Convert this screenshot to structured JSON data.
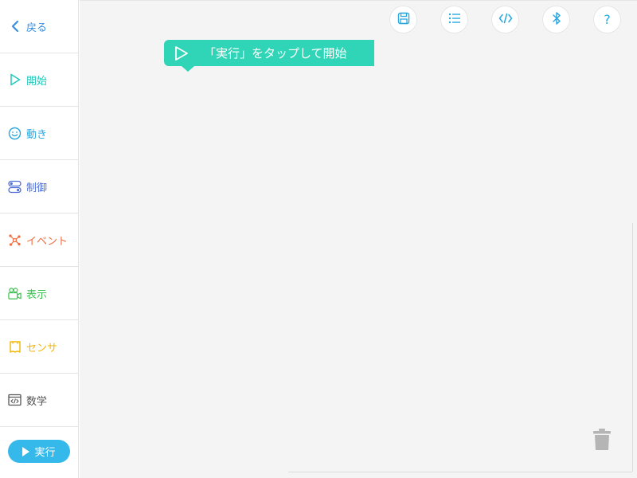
{
  "sidebar": {
    "back": {
      "label": "戻る",
      "icon": "chevron-left-icon",
      "color": "#3a8fe0"
    },
    "items": [
      {
        "label": "開始",
        "icon": "play-outline-icon",
        "color": "#22c7b8"
      },
      {
        "label": "動き",
        "icon": "smiley-icon",
        "color": "#27a6e0"
      },
      {
        "label": "制御",
        "icon": "toggle-control-icon",
        "color": "#4f6fd8"
      },
      {
        "label": "イベント",
        "icon": "network-nodes-icon",
        "color": "#f06b3f"
      },
      {
        "label": "表示",
        "icon": "video-camera-icon",
        "color": "#3ec253"
      },
      {
        "label": "センサ",
        "icon": "sensor-frame-icon",
        "color": "#f2b705"
      },
      {
        "label": "数学",
        "icon": "code-window-icon",
        "color": "#555555"
      }
    ],
    "run_button": {
      "label": "実行",
      "icon": "play-icon",
      "color": "#35b9ea"
    }
  },
  "toolbar": {
    "buttons": [
      {
        "icon": "save-icon"
      },
      {
        "icon": "list-icon"
      },
      {
        "icon": "code-icon"
      },
      {
        "icon": "bluetooth-icon"
      },
      {
        "icon": "help-icon",
        "label": "?"
      }
    ],
    "icon_color": "#29a9e0"
  },
  "canvas": {
    "start_block": {
      "label": "「実行」をタップして開始",
      "color": "#2fd5b6"
    },
    "trash": {
      "icon": "trash-icon",
      "color": "#b5b5b5"
    }
  }
}
